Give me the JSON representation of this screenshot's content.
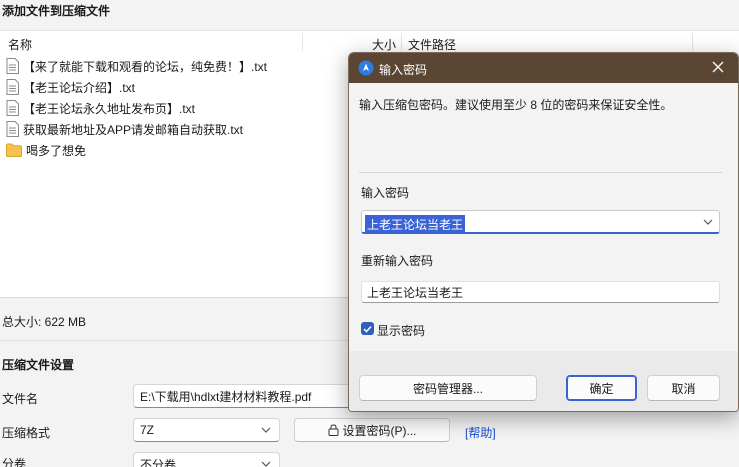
{
  "main": {
    "section_add_files": "添加文件到压缩文件",
    "columns": {
      "name": "名称",
      "size": "大小",
      "path": "文件路径"
    },
    "files": [
      {
        "name": "【来了就能下载和观看的论坛，纯免费！】.txt",
        "icon": "text-file-icon"
      },
      {
        "name": "【老王论坛介绍】.txt",
        "icon": "text-file-icon"
      },
      {
        "name": "【老王论坛永久地址发布页】.txt",
        "icon": "text-file-icon"
      },
      {
        "name": "获取最新地址及APP请发邮箱自动获取.txt",
        "icon": "text-file-icon"
      },
      {
        "name": "喝多了想免",
        "icon": "folder-icon"
      }
    ],
    "total_size": "总大小: 622 MB",
    "section_settings": "压缩文件设置",
    "filename_label": "文件名",
    "filename_value": "E:\\下载用\\hdlxt建材材料教程.pdf",
    "format_label": "压缩格式",
    "format_value": "7Z",
    "set_password_button": "设置密码(P)...",
    "help_link": "[帮助]",
    "split_label": "分卷",
    "split_value": "不分卷"
  },
  "dialog": {
    "title": "输入密码",
    "instruction": "输入压缩包密码。建议使用至少 8 位的密码来保证安全性。",
    "password_label": "输入密码",
    "password_value": "上老王论坛当老王",
    "reenter_label": "重新输入密码",
    "reenter_value": "上老王论坛当老王",
    "show_password_label": "显示密码",
    "show_password_checked": true,
    "password_manager_button": "密码管理器...",
    "ok_button": "确定",
    "cancel_button": "取消"
  },
  "colors": {
    "title_bar": "#5a4632",
    "accent": "#3a63d6",
    "link": "#1a4fd0",
    "folder": "#f4c24d"
  }
}
